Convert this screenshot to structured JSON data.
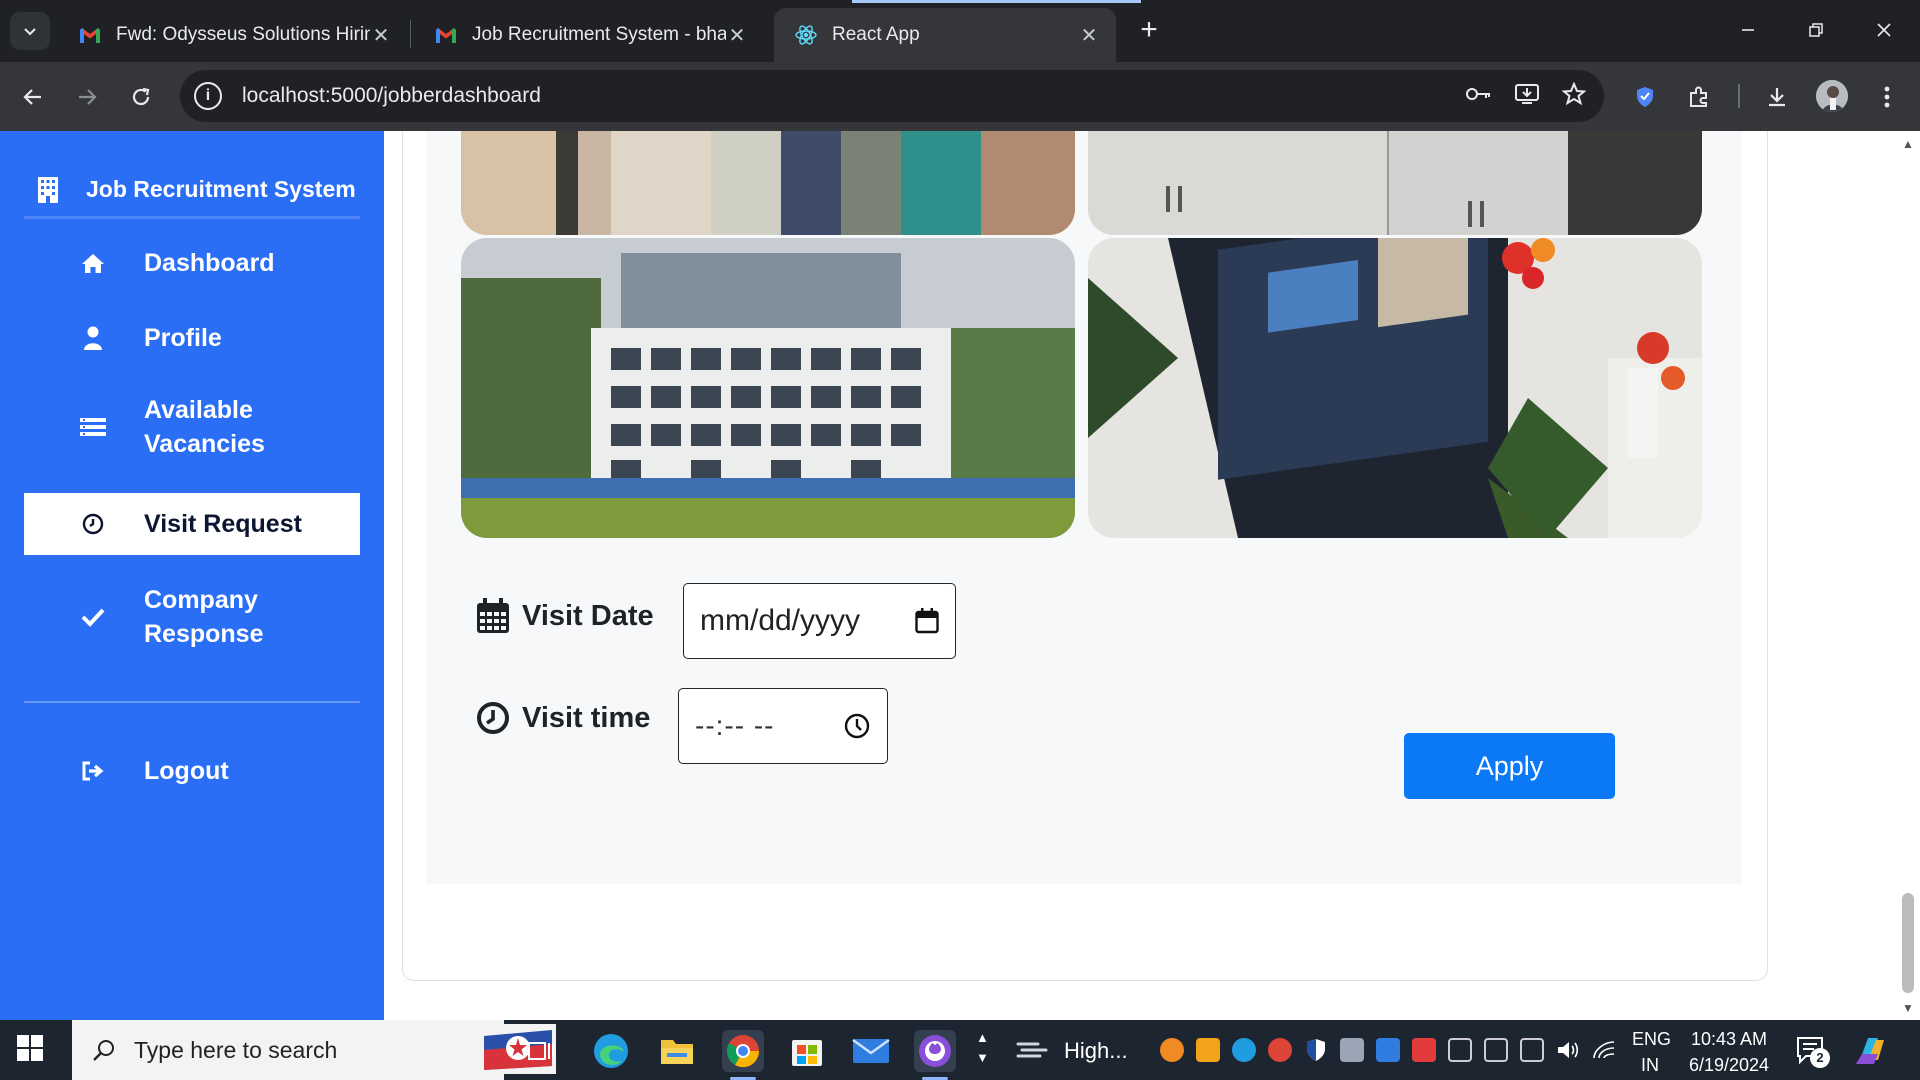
{
  "browser": {
    "tabs": [
      {
        "title": "Fwd: Odysseus Solutions Hiring",
        "icon": "gmail-icon",
        "active": false
      },
      {
        "title": "Job Recruitment System - bhavi",
        "icon": "gmail-icon",
        "active": false
      },
      {
        "title": "React App",
        "icon": "react-icon",
        "active": true
      }
    ],
    "url": "localhost:5000/jobberdashboard"
  },
  "sidebar": {
    "brand": "Job Recruitment System",
    "items": [
      {
        "label": "Dashboard",
        "icon": "home-icon"
      },
      {
        "label": "Profile",
        "icon": "user-icon"
      },
      {
        "label": "Available Vacancies",
        "icon": "list-icon"
      },
      {
        "label": "Visit Request",
        "icon": "clock-icon",
        "active": true
      },
      {
        "label": "Company Response",
        "icon": "check-icon"
      },
      {
        "label": "Logout",
        "icon": "sign-out-icon"
      }
    ]
  },
  "form": {
    "visit_date_label": "Visit Date",
    "visit_date_placeholder": "mm/dd/yyyy",
    "visit_time_label": "Visit time",
    "visit_time_placeholder": "--:-- --",
    "apply_label": "Apply"
  },
  "taskbar": {
    "search_placeholder": "Type here to search",
    "weather_text": "High...",
    "language": "ENG",
    "region": "IN",
    "time": "10:43 AM",
    "date": "6/19/2024",
    "notification_count": "2"
  },
  "colors": {
    "sidebar": "#2a6ef6",
    "apply_button": "#0b78f5",
    "chrome_dark": "#1f2124",
    "taskbar": "#1d2531"
  }
}
